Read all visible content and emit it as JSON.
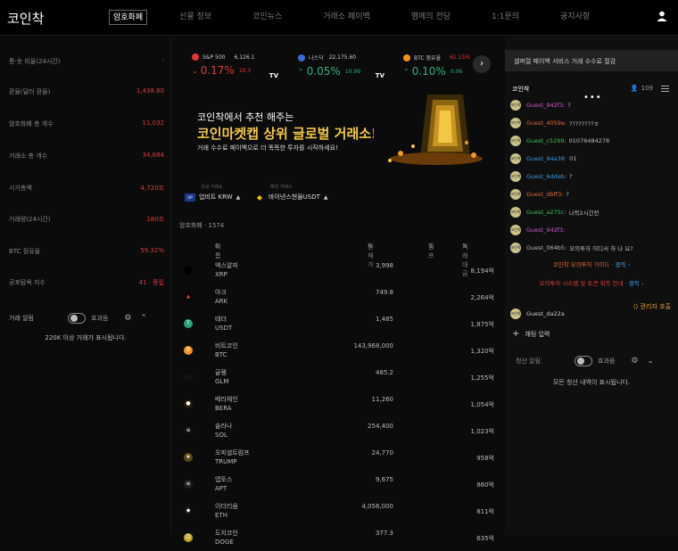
{
  "header": {
    "logo": "코인착",
    "nav": [
      "암호화폐",
      "선물 정보",
      "코인뉴스",
      "거래소 페이백",
      "멤메의 전당",
      "1:1문의",
      "공지사항"
    ]
  },
  "stats": [
    {
      "label": "롱·숏 비율(24시간)",
      "value": "-"
    },
    {
      "label": "환율(달러 환율)",
      "value": "1,438.80"
    },
    {
      "label": "암호화폐 총 개수",
      "value": "11,032"
    },
    {
      "label": "거래소 총 개수",
      "value": "34,684"
    },
    {
      "label": "시가총액",
      "value": "4,720조"
    },
    {
      "label": "거래량(24시간)",
      "value": "180조"
    },
    {
      "label": "BTC 점유율",
      "value": "59.32%"
    },
    {
      "label": "공포탐욕 지수",
      "value": "41 · 중립"
    }
  ],
  "trade_alert": {
    "title": "거래 알림",
    "sound": "효과음",
    "message": "220K 이상 거래가 표시됩니다."
  },
  "tickers": [
    {
      "name": "S&P 500",
      "price": "6,126.1",
      "change": "0.17%",
      "sub": "10.3",
      "dir": "down",
      "color": "#e03a3a"
    },
    {
      "name": "나스닥",
      "price": "22,175.60",
      "change": "0.05%",
      "sub": "10.99",
      "dir": "up",
      "color": "#3a6ad6"
    },
    {
      "name": "BTC 점유율",
      "price": "61.15%",
      "change": "0.10%",
      "sub": "0.06",
      "dir": "up",
      "color": "#f7931a"
    }
  ],
  "tv_label": "TV",
  "banner": {
    "line1": "코인착에서 추천 해주는",
    "line2": "코인마켓캡 상위 글로벌 거래소!",
    "line3": "거래 수수료 페이백으로 더 똑똑한 투자를 시작하세요!"
  },
  "exchange": {
    "left_hint": "국내 거래소",
    "left": "업비트 KRW",
    "right_hint": "해외 거래소",
    "right": "바이낸스현물USDT"
  },
  "count_label": "암호화폐 · 1574",
  "table": {
    "headers": [
      "이름",
      "현재가",
      "김프",
      "거래대금"
    ],
    "rows": [
      {
        "name": "엑스알피",
        "sym": "XRP",
        "price": "3,998",
        "vol": "8,194억",
        "icon": "",
        "color": "#000"
      },
      {
        "name": "아크",
        "sym": "ARK",
        "price": "749.8",
        "vol": "2,264억",
        "icon": "▲",
        "color": "#000"
      },
      {
        "name": "테더",
        "sym": "USDT",
        "price": "1,485",
        "vol": "1,875억",
        "icon": "T",
        "color": "#26a17b"
      },
      {
        "name": "비트코인",
        "sym": "BTC",
        "price": "143,968,000",
        "vol": "1,320억",
        "icon": "B",
        "color": "#f7931a"
      },
      {
        "name": "골렘",
        "sym": "GLM",
        "price": "485.2",
        "vol": "1,255억",
        "icon": "",
        "color": "#111"
      },
      {
        "name": "베라체인",
        "sym": "BERA",
        "price": "11,260",
        "vol": "1,054억",
        "icon": "●",
        "color": "#2a1a0a"
      },
      {
        "name": "솔라나",
        "sym": "SOL",
        "price": "254,400",
        "vol": "1,023억",
        "icon": "≡",
        "color": "#111"
      },
      {
        "name": "오피셜트럼프",
        "sym": "TRUMP",
        "price": "24,770",
        "vol": "958억",
        "icon": "★",
        "color": "#5a4a1a"
      },
      {
        "name": "앱토스",
        "sym": "APT",
        "price": "9,675",
        "vol": "860억",
        "icon": "≡",
        "color": "#222"
      },
      {
        "name": "이더리움",
        "sym": "ETH",
        "price": "4,056,000",
        "vol": "811억",
        "icon": "◆",
        "color": "#111"
      },
      {
        "name": "도지코인",
        "sym": "DOGE",
        "price": "377.3",
        "vol": "635억",
        "icon": "D",
        "color": "#c2a633"
      }
    ]
  },
  "notice": "셀퍼럴 페이백 서비스 거래 수수료 절감",
  "chat": {
    "title": "코인착",
    "count": "109",
    "avatar_text": "코인착",
    "messages": [
      {
        "user": "Guest_942f3:",
        "text": "?",
        "color": "#d05ad0"
      },
      {
        "user": "Guest_4059a:",
        "text": "????????ㅎ",
        "color": "#e06a3a"
      },
      {
        "user": "Guest_c5299:",
        "text": "01076484278",
        "color": "#3ac05a"
      },
      {
        "user": "Guest_94a38:",
        "text": "01",
        "color": "#3a9ae0"
      },
      {
        "user": "Guest_6ddeb:",
        "text": "?",
        "color": "#3a9ae0"
      },
      {
        "user": "Guest_dbff3:",
        "text": "?",
        "color": "#e06a3a"
      },
      {
        "user": "Guest_a275c:",
        "text": "나락2시간전",
        "color": "#3ac05a"
      },
      {
        "user": "Guest_942f3:",
        "text": "",
        "color": "#d05ad0"
      },
      {
        "user": "Guest_064b5:",
        "text": "모의투자 어디서 하 나 요?",
        "color": "#bbbbbb"
      }
    ],
    "sys1_prefix": "코인착 모의투자 가이드",
    "sys1_link": "· 클릭 ›",
    "sys2_prefix": "모의투자 시스템 및 토큰 획득 안내",
    "sys2_link": "· 클릭 ›",
    "last_user": "Guest_da22a",
    "mod_call": "관리자 호출",
    "input": "채팅 입력"
  },
  "liquidation": {
    "title": "청산 알림",
    "sound": "효과음",
    "message": "모든 청산 내역이 표시됩니다."
  }
}
